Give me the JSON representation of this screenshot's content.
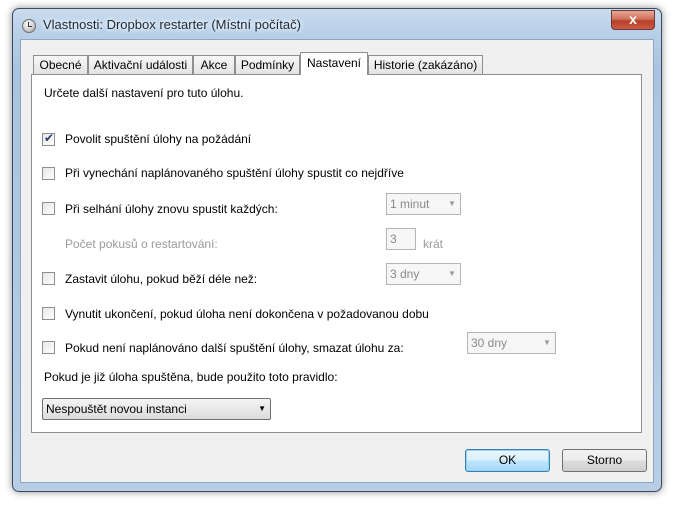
{
  "window": {
    "title": "Vlastnosti: Dropbox restarter (Místní počítač)",
    "close_symbol": "x"
  },
  "tabs": [
    {
      "label": "Obecné"
    },
    {
      "label": "Aktivační události"
    },
    {
      "label": "Akce"
    },
    {
      "label": "Podmínky"
    },
    {
      "label": "Nastavení",
      "active": true
    },
    {
      "label": "Historie (zakázáno)"
    }
  ],
  "settings": {
    "intro": "Určete další nastavení pro tuto úlohu.",
    "allow_on_demand": {
      "label": "Povolit spuštění úlohy na požádání",
      "checked": true
    },
    "run_asap": {
      "label": "Při vynechání naplánovaného spuštění úlohy spustit co nejdříve",
      "checked": false
    },
    "restart_on_fail": {
      "label": "Při selhání úlohy znovu spustit každých:",
      "checked": false,
      "interval": "1 minut"
    },
    "restart_attempts": {
      "label": "Počet pokusů o restartování:",
      "value": "3",
      "unit": "krát"
    },
    "stop_if_longer": {
      "label": "Zastavit úlohu, pokud běží déle než:",
      "checked": false,
      "value": "3 dny"
    },
    "force_stop": {
      "label": "Vynutit ukončení, pokud úloha není dokončena v požadovanou dobu",
      "checked": false
    },
    "delete_if_not_scheduled": {
      "label": "Pokud není naplánováno další spuštění úlohy, smazat úlohu za:",
      "checked": false,
      "value": "30 dny"
    },
    "running_rule_label": "Pokud je již úloha spuštěna, bude použito toto pravidlo:",
    "running_rule_value": "Nespouštět novou instanci"
  },
  "buttons": {
    "ok": "OK",
    "cancel": "Storno"
  }
}
